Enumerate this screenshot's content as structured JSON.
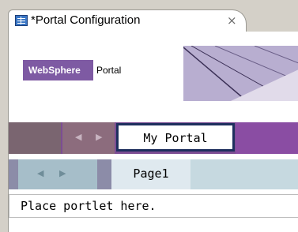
{
  "editor": {
    "tab_title": "*Portal Configuration",
    "close_glyph": "×",
    "tab_icon": "portal-config-icon"
  },
  "logo": {
    "brand": "WebSphere",
    "product": "Portal"
  },
  "nav_primary": {
    "prev_glyph": "◀",
    "next_glyph": "▶",
    "selected_tab": "My Portal"
  },
  "nav_secondary": {
    "prev_glyph": "◀",
    "next_glyph": "▶",
    "selected_tab": "Page1"
  },
  "placeholder": {
    "text": "Place portlet here."
  },
  "colors": {
    "brand_purple": "#7e5aa3",
    "nav_border": "#1e2f5e",
    "nav_bar": "#7c4d93",
    "subnav_bar": "#c6d9e0"
  }
}
